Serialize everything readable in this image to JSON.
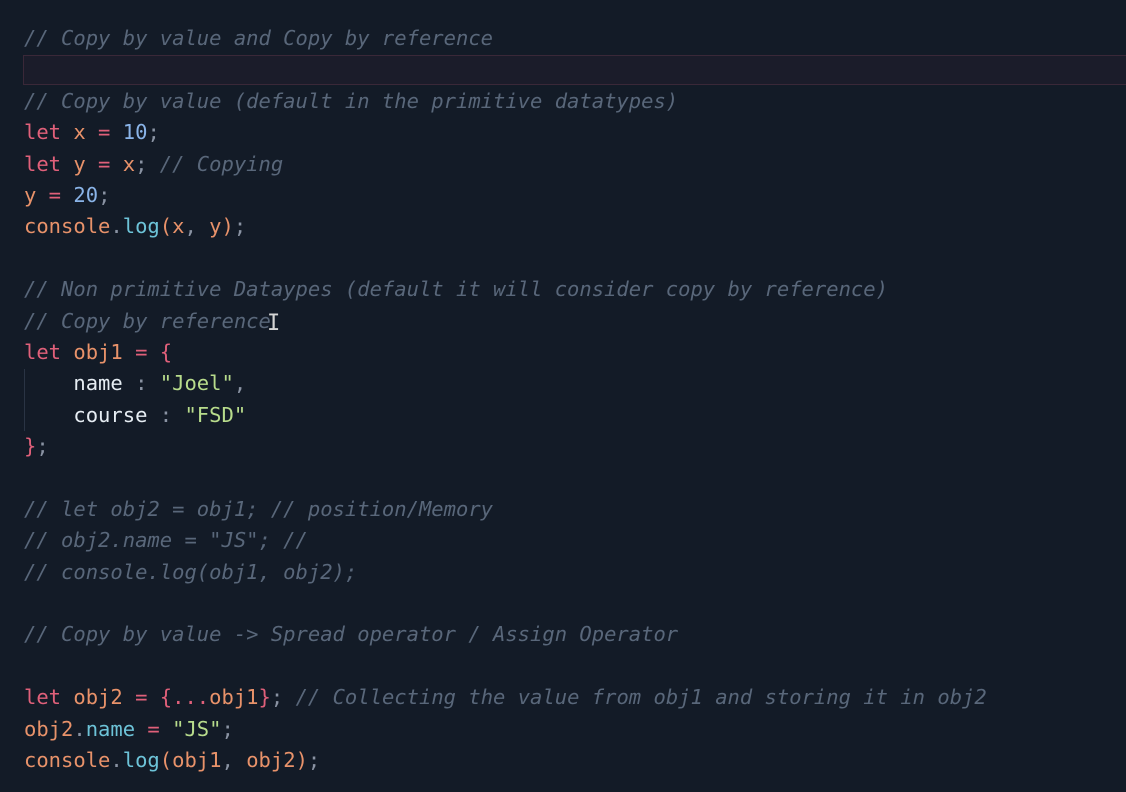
{
  "editor": {
    "lines": [
      {
        "parts": [
          {
            "t": "// Copy by value and Copy by reference",
            "c": "cm"
          }
        ]
      },
      {
        "parts": []
      },
      {
        "parts": [
          {
            "t": "// Copy by value (default in the primitive datatypes)",
            "c": "cm"
          }
        ]
      },
      {
        "parts": [
          {
            "t": "let",
            "c": "kw"
          },
          {
            "t": " ",
            "c": ""
          },
          {
            "t": "x",
            "c": "var"
          },
          {
            "t": " = ",
            "c": "op"
          },
          {
            "t": "10",
            "c": "num"
          },
          {
            "t": ";",
            "c": "pn"
          }
        ]
      },
      {
        "parts": [
          {
            "t": "let",
            "c": "kw"
          },
          {
            "t": " ",
            "c": ""
          },
          {
            "t": "y",
            "c": "var"
          },
          {
            "t": " = ",
            "c": "op"
          },
          {
            "t": "x",
            "c": "var"
          },
          {
            "t": "; ",
            "c": "pn"
          },
          {
            "t": "// Copying",
            "c": "cm"
          }
        ]
      },
      {
        "parts": [
          {
            "t": "y",
            "c": "var"
          },
          {
            "t": " = ",
            "c": "op"
          },
          {
            "t": "20",
            "c": "num"
          },
          {
            "t": ";",
            "c": "pn"
          }
        ]
      },
      {
        "parts": [
          {
            "t": "console",
            "c": "var"
          },
          {
            "t": ".",
            "c": "pn"
          },
          {
            "t": "log",
            "c": "fn"
          },
          {
            "t": "(",
            "c": "var"
          },
          {
            "t": "x",
            "c": "var"
          },
          {
            "t": ", ",
            "c": "pn"
          },
          {
            "t": "y",
            "c": "var"
          },
          {
            "t": ")",
            "c": "var"
          },
          {
            "t": ";",
            "c": "pn"
          }
        ]
      },
      {
        "parts": []
      },
      {
        "parts": [
          {
            "t": "// Non primitive Dataypes (default it will consider copy by reference)",
            "c": "cm"
          }
        ]
      },
      {
        "parts": [
          {
            "t": "// Copy by reference",
            "c": "cm"
          }
        ]
      },
      {
        "parts": [
          {
            "t": "let",
            "c": "kw"
          },
          {
            "t": " ",
            "c": ""
          },
          {
            "t": "obj1",
            "c": "var"
          },
          {
            "t": " = ",
            "c": "op"
          },
          {
            "t": "{",
            "c": "brace"
          }
        ]
      },
      {
        "parts": [
          {
            "t": "    ",
            "c": ""
          },
          {
            "t": "name",
            "c": "key"
          },
          {
            "t": " : ",
            "c": "pn"
          },
          {
            "t": "\"Joel\"",
            "c": "str"
          },
          {
            "t": ",",
            "c": "pn"
          }
        ]
      },
      {
        "parts": [
          {
            "t": "    ",
            "c": ""
          },
          {
            "t": "course",
            "c": "key"
          },
          {
            "t": " : ",
            "c": "pn"
          },
          {
            "t": "\"FSD\"",
            "c": "str"
          }
        ]
      },
      {
        "parts": [
          {
            "t": "}",
            "c": "brace"
          },
          {
            "t": ";",
            "c": "pn"
          }
        ]
      },
      {
        "parts": []
      },
      {
        "parts": [
          {
            "t": "// let obj2 = obj1; // position/Memory",
            "c": "cm"
          }
        ]
      },
      {
        "parts": [
          {
            "t": "// obj2.name = \"JS\"; //",
            "c": "cm"
          }
        ]
      },
      {
        "parts": [
          {
            "t": "// console.log(obj1, obj2);",
            "c": "cm"
          }
        ]
      },
      {
        "parts": []
      },
      {
        "parts": [
          {
            "t": "// Copy by value -> Spread operator / Assign Operator",
            "c": "cm"
          }
        ]
      },
      {
        "parts": []
      },
      {
        "parts": [
          {
            "t": "let",
            "c": "kw"
          },
          {
            "t": " ",
            "c": ""
          },
          {
            "t": "obj2",
            "c": "var"
          },
          {
            "t": " = ",
            "c": "op"
          },
          {
            "t": "{",
            "c": "brace"
          },
          {
            "t": "...",
            "c": "op"
          },
          {
            "t": "obj1",
            "c": "var"
          },
          {
            "t": "}",
            "c": "brace"
          },
          {
            "t": "; ",
            "c": "pn"
          },
          {
            "t": "// Collecting the value from obj1 and storing it in obj2",
            "c": "cm"
          }
        ]
      },
      {
        "parts": [
          {
            "t": "obj2",
            "c": "var"
          },
          {
            "t": ".",
            "c": "pn"
          },
          {
            "t": "name",
            "c": "prop"
          },
          {
            "t": " = ",
            "c": "op"
          },
          {
            "t": "\"JS\"",
            "c": "str"
          },
          {
            "t": ";",
            "c": "pn"
          }
        ]
      },
      {
        "parts": [
          {
            "t": "console",
            "c": "var"
          },
          {
            "t": ".",
            "c": "pn"
          },
          {
            "t": "log",
            "c": "fn"
          },
          {
            "t": "(",
            "c": "var"
          },
          {
            "t": "obj1",
            "c": "var"
          },
          {
            "t": ", ",
            "c": "pn"
          },
          {
            "t": "obj2",
            "c": "var"
          },
          {
            "t": ")",
            "c": "var"
          },
          {
            "t": ";",
            "c": "pn"
          }
        ]
      }
    ],
    "cursor_glyph": "I",
    "colors": {
      "background": "#131b27",
      "comment": "#59677a",
      "keyword": "#e0607a",
      "variable": "#e8926a",
      "number": "#8ab4e8",
      "string": "#b8dc8c",
      "function": "#6dc3d8"
    }
  }
}
